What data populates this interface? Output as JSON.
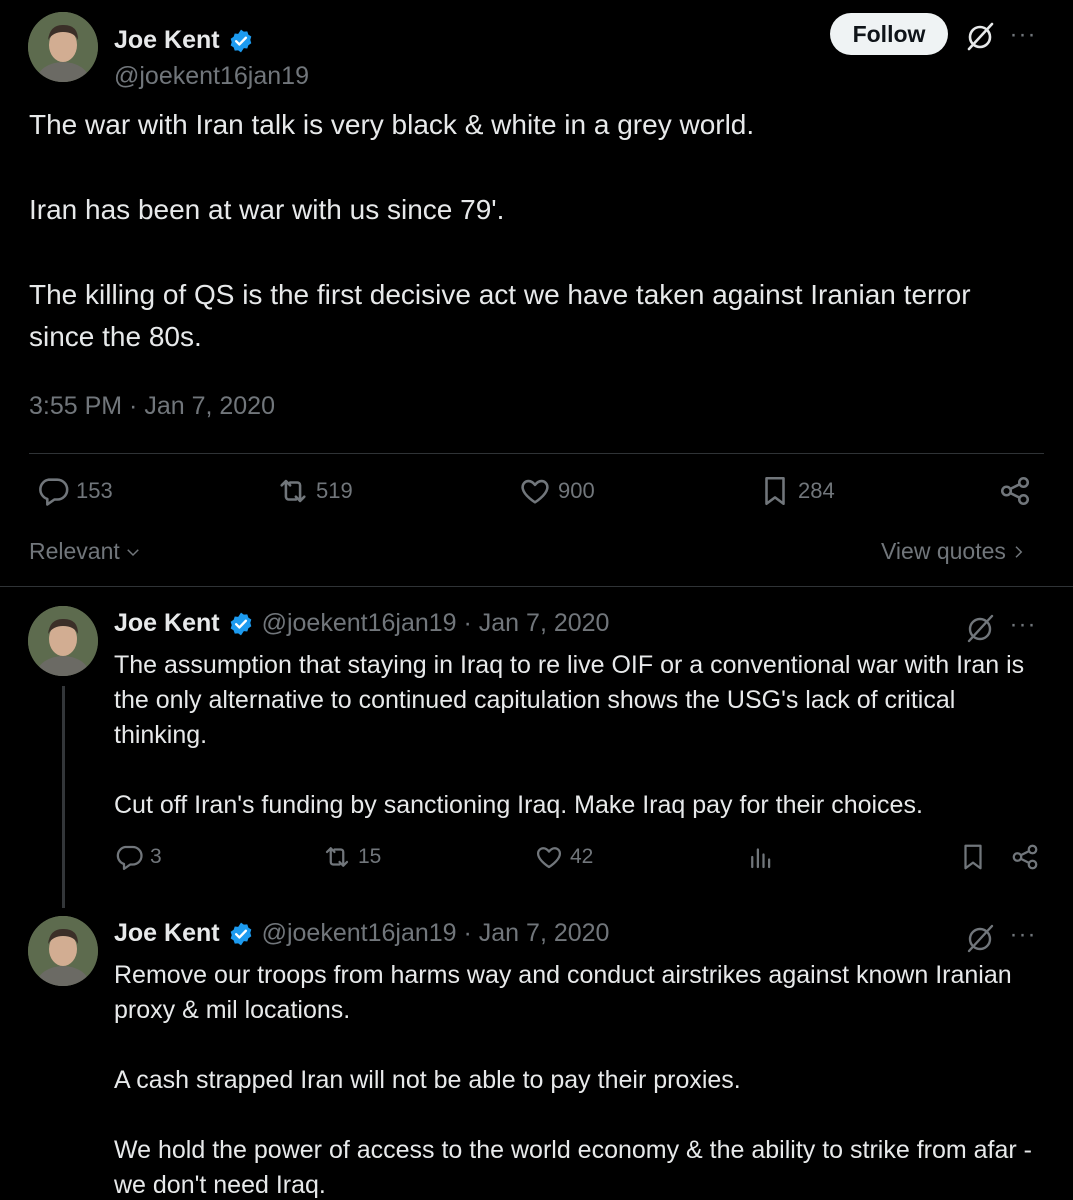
{
  "main_tweet": {
    "author_name": "Joe Kent",
    "handle": "@joekent16jan19",
    "follow_label": "Follow",
    "paragraphs": [
      "The war with Iran talk is very black & white in a grey world.",
      "Iran has been at war with us since 79'.",
      "The killing of QS is the first decisive act we have taken against Iranian terror since the 80s."
    ],
    "timestamp": "3:55 PM · Jan 7, 2020",
    "stats": {
      "replies": "153",
      "reposts": "519",
      "likes": "900",
      "bookmarks": "284"
    }
  },
  "sort": {
    "relevant_label": "Relevant",
    "view_quotes_label": "View quotes"
  },
  "replies": [
    {
      "author_name": "Joe Kent",
      "handle_date": "@joekent16jan19 · Jan 7, 2020",
      "paragraphs": [
        "The assumption that staying in Iraq to re live OIF or a conventional war with Iran is the only alternative to continued capitulation shows the USG's lack of critical thinking.",
        "Cut off Iran's funding by sanctioning Iraq. Make Iraq pay for their choices."
      ],
      "stats": {
        "replies": "3",
        "reposts": "15",
        "likes": "42"
      }
    },
    {
      "author_name": "Joe Kent",
      "handle_date": "@joekent16jan19 · Jan 7, 2020",
      "paragraphs": [
        "Remove our troops from harms way and conduct airstrikes against known Iranian proxy & mil locations.",
        "A cash strapped Iran will not be able to pay their proxies.",
        "We hold the power of access to the world economy & the ability to strike from afar - we don't need Iraq."
      ]
    }
  ],
  "colors": {
    "background": "#000000",
    "text": "#e7e9ea",
    "muted": "#71767b",
    "verified": "#1d9bf0",
    "divider": "#2f3336"
  },
  "icons": {
    "verified": "verified-badge-icon",
    "grok": "grok-icon",
    "more": "more-icon",
    "reply": "reply-icon",
    "repost": "repost-icon",
    "like": "like-icon",
    "bookmark": "bookmark-icon",
    "share": "share-icon",
    "views": "views-icon"
  }
}
